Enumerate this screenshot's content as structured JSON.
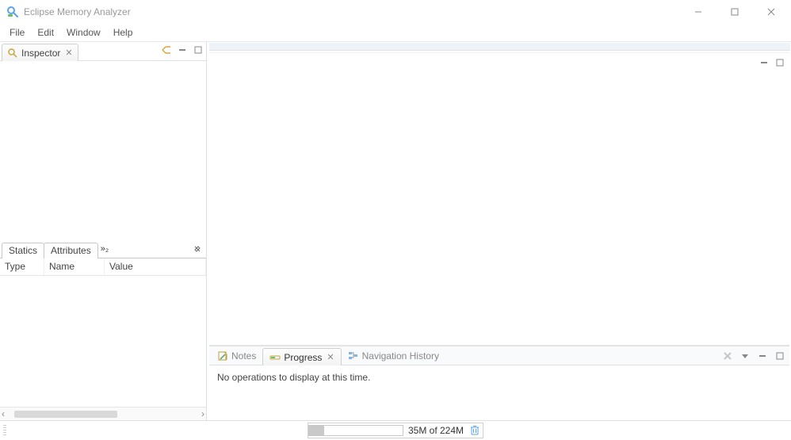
{
  "window": {
    "title": "Eclipse Memory Analyzer"
  },
  "menu": {
    "items": [
      "File",
      "Edit",
      "Window",
      "Help"
    ]
  },
  "inspector": {
    "tab_label": "Inspector",
    "sub_tabs": {
      "statics": "Statics",
      "attributes": "Attributes",
      "overflow": "»₂"
    },
    "columns": {
      "type": "Type",
      "name": "Name",
      "value": "Value"
    }
  },
  "bottom": {
    "notes": "Notes",
    "progress": "Progress",
    "history": "Navigation History",
    "message": "No operations to display at this time."
  },
  "status": {
    "heap": "35M of 224M"
  }
}
